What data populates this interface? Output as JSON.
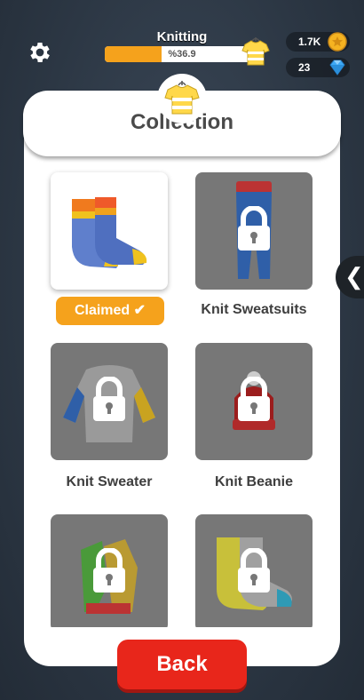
{
  "topbar": {
    "progress_title": "Knitting",
    "progress_text": "%36.9",
    "progress_fraction": 0.369,
    "coins": "1.7K",
    "gems": "23",
    "icons": {
      "settings": "gear-icon",
      "coin": "coin-icon",
      "gem": "diamond-icon",
      "shirt": "shirt-icon"
    }
  },
  "panel": {
    "title": "Collection"
  },
  "items": [
    {
      "label": "",
      "status": "Claimed"
    },
    {
      "label": "Knit Sweatsuits",
      "status": "locked"
    },
    {
      "label": "Knit Sweater",
      "status": "locked"
    },
    {
      "label": "Knit Beanie",
      "status": "locked"
    },
    {
      "label": "",
      "status": "locked"
    },
    {
      "label": "",
      "status": "locked"
    }
  ],
  "buttons": {
    "back": "Back",
    "side_tab": "❮"
  },
  "colors": {
    "accent": "#f5a21c",
    "back": "#e8261b",
    "locked_card": "#777777"
  }
}
